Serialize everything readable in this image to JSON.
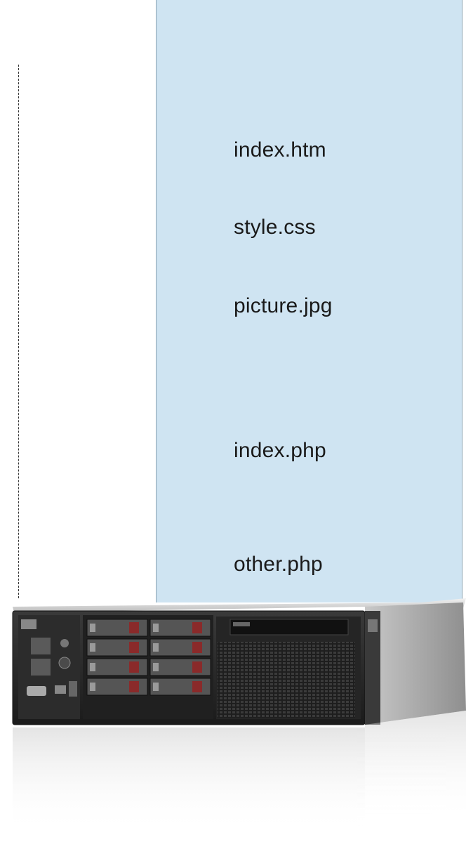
{
  "files": {
    "file1": "index.htm",
    "file2": "style.css",
    "file3": "picture.jpg",
    "file4": "index.php",
    "file5": "other.php"
  },
  "server": {
    "icon": "rack-server-icon"
  }
}
